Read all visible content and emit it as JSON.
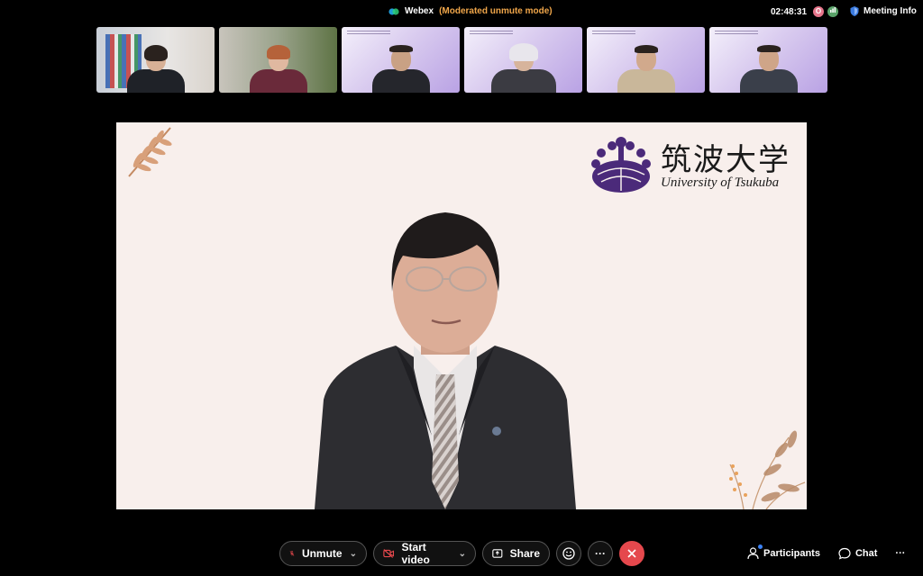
{
  "header": {
    "app_name": "Webex",
    "mode": "(Moderated unmute mode)",
    "time": "02:48:31",
    "rec_badge": "O",
    "meeting_info": "Meeting Info"
  },
  "stage": {
    "logo_jp": "筑波大学",
    "logo_en": "University of Tsukuba"
  },
  "controls": {
    "unmute": "Unmute",
    "start_video": "Start video",
    "share": "Share",
    "more": "···",
    "participants": "Participants",
    "chat": "Chat",
    "overflow": "···"
  },
  "colors": {
    "accent_mode": "#f0a64a",
    "end_call": "#e5484d",
    "stage_bg": "#f8efec",
    "logo_purple": "#4b2a7a"
  }
}
